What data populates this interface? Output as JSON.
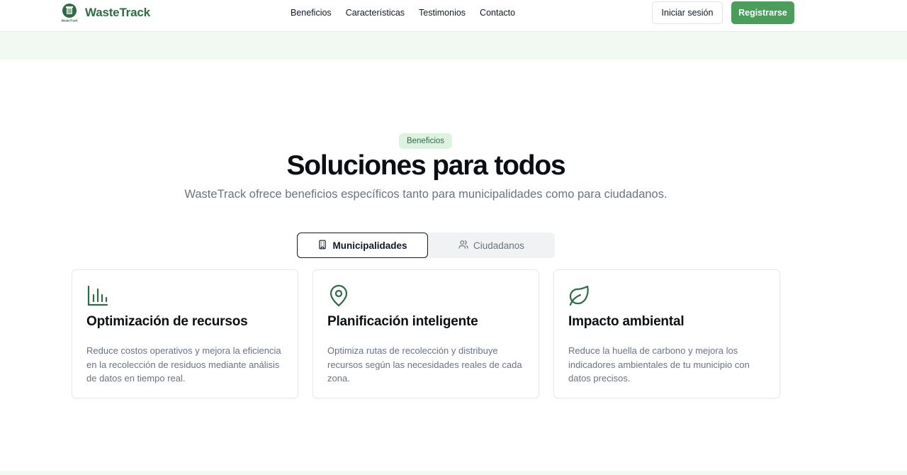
{
  "brand": {
    "name": "WasteTrack",
    "logo_small_text": "WasteTrack"
  },
  "nav": {
    "items": [
      "Beneficios",
      "Características",
      "Testimonios",
      "Contacto"
    ]
  },
  "auth": {
    "login_label": "Iniciar sesión",
    "register_label": "Registrarse"
  },
  "hero": {
    "badge": "Beneficios",
    "title": "Soluciones para todos",
    "subtitle": "WasteTrack ofrece beneficios específicos tanto para municipalidades como para ciudadanos."
  },
  "tabs": [
    {
      "label": "Municipalidades",
      "icon": "building-icon",
      "active": true
    },
    {
      "label": "Ciudadanos",
      "icon": "users-icon",
      "active": false
    }
  ],
  "cards": [
    {
      "icon": "bar-chart-icon",
      "title": "Optimización de recursos",
      "description": "Reduce costos operativos y mejora la eficiencia en la recolección de residuos mediante análisis de datos en tiempo real."
    },
    {
      "icon": "map-pin-icon",
      "title": "Planificación inteligente",
      "description": "Optimiza rutas de recolección y distribuye recursos según las necesidades reales de cada zona."
    },
    {
      "icon": "leaf-icon",
      "title": "Impacto ambiental",
      "description": "Reduce la huella de carbono y mejora los indicadores ambientales de tu municipio con datos precisos."
    }
  ],
  "colors": {
    "brand_green": "#2f6b45",
    "button_green": "#4a9d5b",
    "badge_bg": "#dcf3df",
    "strip_bg": "#f1faf2"
  }
}
